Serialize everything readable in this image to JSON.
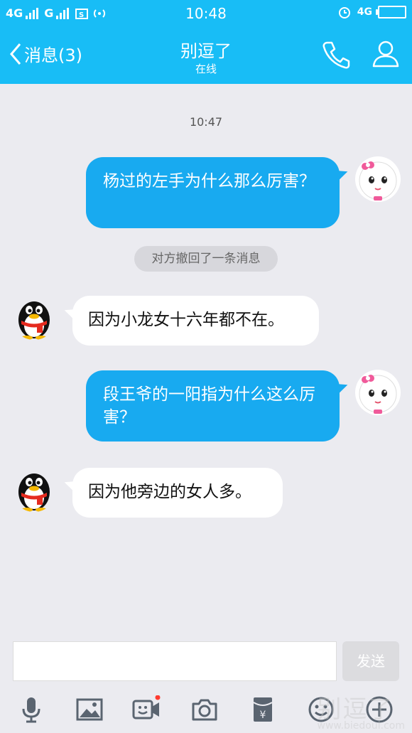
{
  "status_bar": {
    "network_1": "4G",
    "network_2": "G",
    "time": "10:48",
    "network_right": "4G"
  },
  "header": {
    "back_label": "消息(3)",
    "title": "别逗了",
    "subtitle": "在线"
  },
  "chat": {
    "time_label": "10:47",
    "messages": [
      {
        "direction": "outgoing",
        "text": "杨过的左手为什么那么厉害？"
      },
      {
        "direction": "system",
        "text": "对方撤回了一条消息"
      },
      {
        "direction": "incoming",
        "text": "因为小龙女十六年都不在。"
      },
      {
        "direction": "outgoing",
        "text": "段王爷的一阳指为什么这么厉害？"
      },
      {
        "direction": "incoming",
        "text": "因为他旁边的女人多。"
      }
    ]
  },
  "input": {
    "placeholder": "",
    "send_label": "发送"
  },
  "toolbar": {
    "icons": [
      "microphone-icon",
      "image-icon",
      "video-call-icon",
      "camera-icon",
      "red-packet-icon",
      "emoji-icon",
      "plus-icon"
    ]
  },
  "watermark": {
    "text": "别逗了",
    "url": "www.biedoul.com"
  },
  "colors": {
    "brand": "#18bdf6",
    "outgoing_bubble": "#18aaf0",
    "background": "#ebebf0"
  }
}
